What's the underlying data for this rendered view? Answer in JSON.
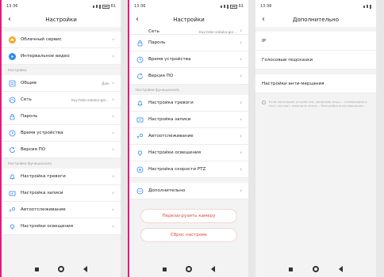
{
  "status": {
    "time": "13:36",
    "battery": "61"
  },
  "screen1": {
    "title": "Настройки",
    "items_top": [
      {
        "label": "Облачный сервис",
        "icon": "cloud-icon",
        "color": "#f5a623"
      },
      {
        "label": "Интервальное видео",
        "icon": "timelapse-icon",
        "color": "#2e8bf0"
      }
    ],
    "section1": "Настройки",
    "items_mid": [
      {
        "label": "Общие",
        "value": "Дом"
      },
      {
        "label": "Сеть",
        "value": "Huy-tebe-sobaka-gor..."
      },
      {
        "label": "Пароль",
        "value": ""
      },
      {
        "label": "Время устройства",
        "value": ""
      },
      {
        "label": "Версия ПО",
        "value": ""
      }
    ],
    "section2": "Настройки функционала",
    "items_bottom": [
      {
        "label": "Настройка тревоги"
      },
      {
        "label": "Настройка записи"
      },
      {
        "label": "Автоотслеживание"
      },
      {
        "label": "Настройки освещения"
      }
    ]
  },
  "screen2": {
    "title": "Настройки",
    "items_top": [
      {
        "label": "Сеть",
        "value": "Huy-tebe-sobaka-gor..."
      },
      {
        "label": "Пароль",
        "value": ""
      },
      {
        "label": "Время устройства",
        "value": ""
      },
      {
        "label": "Версия ПО",
        "value": ""
      }
    ],
    "section": "Настройки функционала",
    "items_func": [
      {
        "label": "Настройка тревоги"
      },
      {
        "label": "Настройка записи"
      },
      {
        "label": "Автоотслеживание"
      },
      {
        "label": "Настройки освещения"
      },
      {
        "label": "Настройка скорости PTZ"
      }
    ],
    "advanced": "Дополнительно",
    "restart": "Перезагрузить камеру",
    "reset": "Сброс настроек"
  },
  "screen3": {
    "title": "Дополнительно",
    "items": [
      {
        "label": "IP"
      },
      {
        "label": "Голосовые подсказки"
      }
    ],
    "flicker": "Настройки анти-мерцания",
    "note": "Если некоторые устройства, например мерц... телевизоров и свет, мигают, измените значе... Настройки анти-мерцания."
  },
  "colors": {
    "accent": "#2e8bf0",
    "danger": "#e0453a"
  }
}
